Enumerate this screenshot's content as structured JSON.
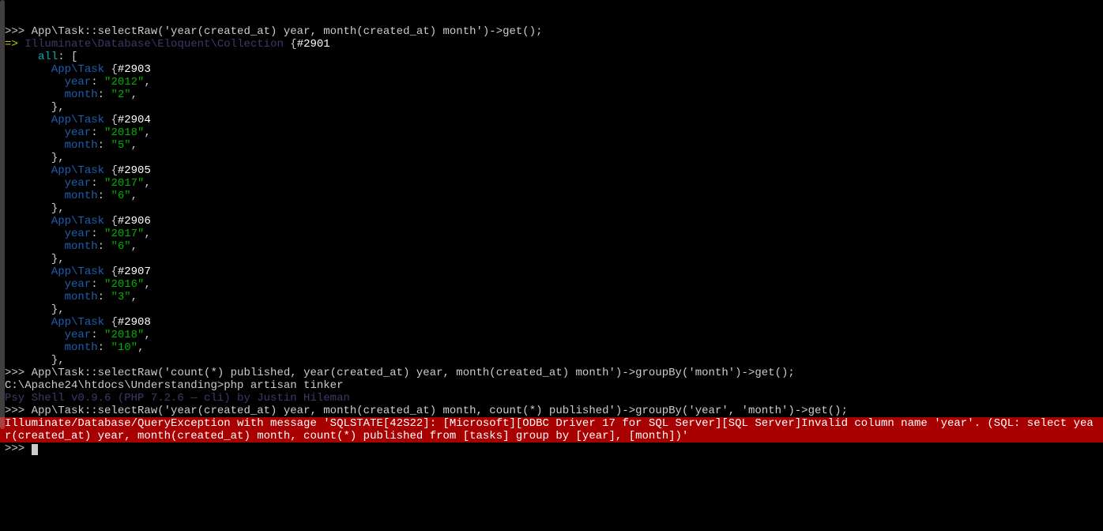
{
  "colors": {
    "background": "#000000",
    "default_text": "#cccccc",
    "class_blue": "#1e5fad",
    "kw_cyan": "#00b0b0",
    "string_green": "#00b000",
    "arrow_yellow": "#c8c800",
    "muted_purple": "#3a3a6a",
    "error_bg": "#a80000",
    "error_fg": "#ffffff",
    "bright": "#ffffff"
  },
  "commands": {
    "query_first": "App\\Task::selectRaw('year(created_at) year, month(created_at) month')->get();",
    "query_second": "App\\Task::selectRaw('count(*) published, year(created_at) year, month(created_at) month')->groupBy('month')->get();",
    "query_third": "App\\Task::selectRaw('year(created_at) year, month(created_at) month, count(*) published')->groupBy('year', 'month')->get();"
  },
  "prompt": ">>> ",
  "arrow": "=> ",
  "shell_path": "C:\\Apache24\\htdocs\\Understanding>",
  "shell_cmd": "php artisan tinker",
  "psy_banner": "Psy Shell v0.9.6 (PHP 7.2.6 — cli) by Justin Hileman",
  "result": {
    "wrapper_class": "Illuminate\\Database\\Eloquent\\Collection",
    "wrapper_id": "#2901",
    "all_key": "all",
    "item_class": "App\\Task",
    "items": [
      {
        "id": "#2903",
        "year": "2012",
        "month": "2"
      },
      {
        "id": "#2904",
        "year": "2018",
        "month": "5"
      },
      {
        "id": "#2905",
        "year": "2017",
        "month": "6"
      },
      {
        "id": "#2906",
        "year": "2017",
        "month": "6"
      },
      {
        "id": "#2907",
        "year": "2016",
        "month": "3"
      },
      {
        "id": "#2908",
        "year": "2018",
        "month": "10"
      }
    ]
  },
  "labels": {
    "year": "year",
    "month": "month"
  },
  "error": {
    "exception_label": "Illuminate/Database/QueryException with message ",
    "message": "'SQLSTATE[42S22]: [Microsoft][ODBC Driver 17 for SQL Server][SQL Server]Invalid column name 'year'. (SQL: select year(created_at) year, month(created_at) month, count(*) published from [tasks] group by [year], [month])'"
  }
}
